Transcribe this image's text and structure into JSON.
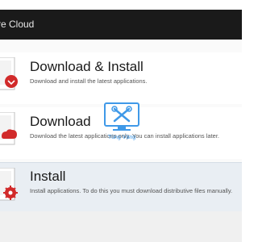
{
  "window": {
    "title": "re Cloud"
  },
  "options": [
    {
      "title": "Download & Install",
      "description": "Download and install the latest applications.",
      "icon": "package-install-icon"
    },
    {
      "title": "Download",
      "description": "Download the latest applications only. You can install applications later.",
      "icon": "package-download-icon"
    },
    {
      "title": "Install",
      "description": "Install applications. To do this you must download distributive files manually.",
      "icon": "package-gear-icon",
      "hovered": true
    }
  ],
  "colors": {
    "titlebar": "#1a1a1a",
    "accent_red": "#d12a2a",
    "hover_bg": "#e9eef3"
  },
  "watermark": {
    "icon": "tools-monitor-icon",
    "text": "Tùng Vàng"
  }
}
